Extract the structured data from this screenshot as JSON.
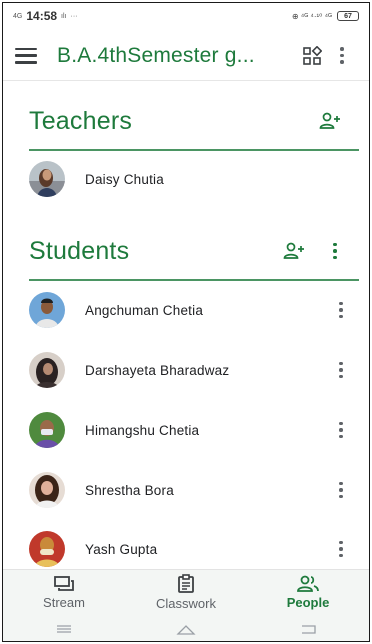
{
  "status_bar": {
    "net_left": "4G",
    "time": "14:58",
    "signal_small": "ılı",
    "ellipsis": "···",
    "right_icons": "⊕ ⁴ᴳ ⁴·¹⁰ ⁴ᴳ",
    "battery": "67"
  },
  "app_bar": {
    "title": "B.A.4thSemester g...",
    "menu_icon": "hamburger-icon",
    "qr_icon": "qr-code-icon",
    "overflow_icon": "more-vert-icon"
  },
  "teachers": {
    "title": "Teachers",
    "add_icon": "person-add-icon",
    "items": [
      {
        "name": "Daisy Chutia"
      }
    ]
  },
  "students": {
    "title": "Students",
    "add_icon": "person-add-icon",
    "items": [
      {
        "name": "Angchuman Chetia"
      },
      {
        "name": "Darshayeta Bharadwaz"
      },
      {
        "name": "Himangshu Chetia"
      },
      {
        "name": "Shrestha Bora"
      },
      {
        "name": "Yash Gupta"
      }
    ]
  },
  "bottom_nav": {
    "items": [
      {
        "label": "Stream",
        "icon": "stream-icon",
        "active": false
      },
      {
        "label": "Classwork",
        "icon": "classwork-icon",
        "active": false
      },
      {
        "label": "People",
        "icon": "people-icon",
        "active": true
      }
    ]
  },
  "colors": {
    "accent": "#1e7a3c",
    "text": "#202124",
    "muted": "#5f6368",
    "nav_bg": "#f3f6f4"
  }
}
